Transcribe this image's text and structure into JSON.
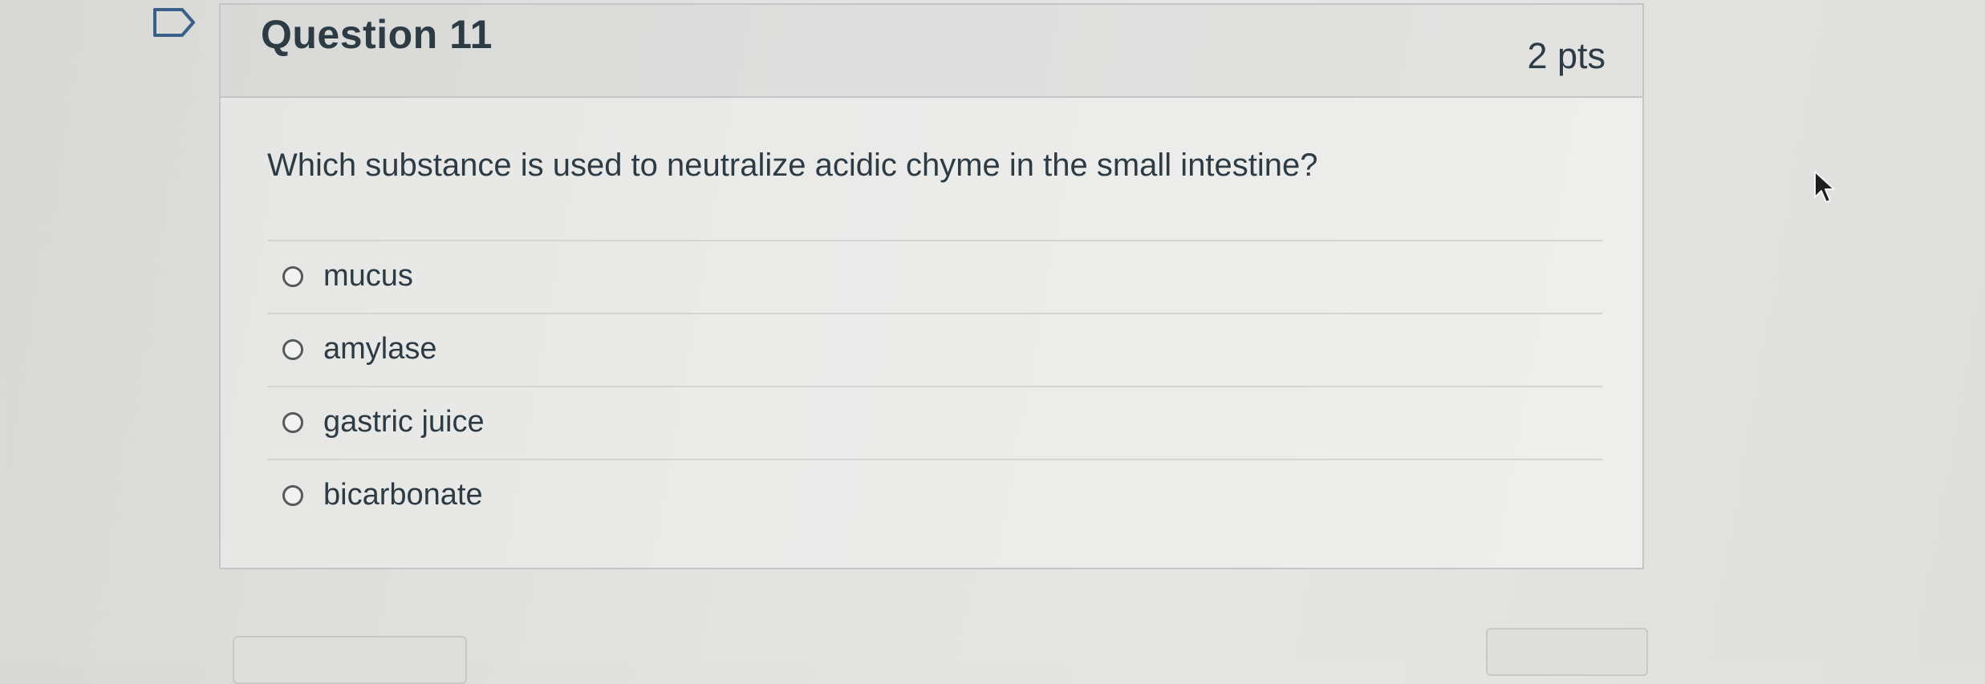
{
  "question": {
    "title": "Question 11",
    "points": "2 pts",
    "prompt": "Which substance is used to neutralize acidic chyme in the small intestine?"
  },
  "answers": [
    {
      "label": "mucus",
      "selected": false
    },
    {
      "label": "amylase",
      "selected": false
    },
    {
      "label": "gastric juice",
      "selected": false
    },
    {
      "label": "bicarbonate",
      "selected": false
    }
  ],
  "icons": {
    "flag": "flag-question-icon",
    "cursor": "mouse-pointer-icon"
  },
  "colors": {
    "text": "#2d3b45",
    "border": "#c4c6c6",
    "header_bg": "#dcdcda"
  }
}
